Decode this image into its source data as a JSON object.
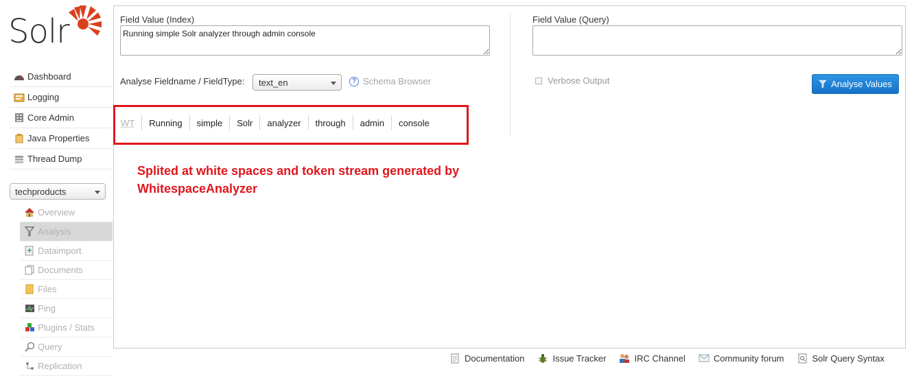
{
  "logo": {
    "text": "Solr"
  },
  "main_nav": [
    {
      "label": "Dashboard",
      "icon": "dashboard-icon"
    },
    {
      "label": "Logging",
      "icon": "logging-icon"
    },
    {
      "label": "Core Admin",
      "icon": "core-admin-icon"
    },
    {
      "label": "Java Properties",
      "icon": "java-properties-icon"
    },
    {
      "label": "Thread Dump",
      "icon": "thread-dump-icon"
    }
  ],
  "core_selector": {
    "value": "techproducts"
  },
  "core_nav": [
    {
      "label": "Overview",
      "icon": "overview-icon"
    },
    {
      "label": "Analysis",
      "icon": "analysis-icon",
      "active": true
    },
    {
      "label": "Dataimport",
      "icon": "dataimport-icon"
    },
    {
      "label": "Documents",
      "icon": "documents-icon"
    },
    {
      "label": "Files",
      "icon": "files-icon"
    },
    {
      "label": "Ping",
      "icon": "ping-icon"
    },
    {
      "label": "Plugins / Stats",
      "icon": "plugins-icon"
    },
    {
      "label": "Query",
      "icon": "query-icon"
    },
    {
      "label": "Replication",
      "icon": "replication-icon"
    }
  ],
  "analysis": {
    "index_label": "Field Value (Index)",
    "index_value": "Running simple Solr analyzer through admin console",
    "query_label": "Field Value (Query)",
    "query_value": "",
    "fieldtype_label": "Analyse Fieldname / FieldType:",
    "fieldtype_value": "text_en",
    "schema_browser_label": "Schema Browser",
    "verbose_label": "Verbose Output",
    "analyse_button_label": "Analyse Values"
  },
  "tokens": {
    "stage": "WT",
    "items": [
      "Running",
      "simple",
      "Solr",
      "analyzer",
      "through",
      "admin",
      "console"
    ]
  },
  "annotation": {
    "line1": "Splited at white spaces and token stream generated by",
    "line2": "WhitespaceAnalyzer",
    "color": "#e0161d"
  },
  "footer": [
    {
      "label": "Documentation",
      "icon": "documentation-icon"
    },
    {
      "label": "Issue Tracker",
      "icon": "bug-icon"
    },
    {
      "label": "IRC Channel",
      "icon": "irc-icon"
    },
    {
      "label": "Community forum",
      "icon": "mail-icon"
    },
    {
      "label": "Solr Query Syntax",
      "icon": "query-syntax-icon"
    }
  ]
}
